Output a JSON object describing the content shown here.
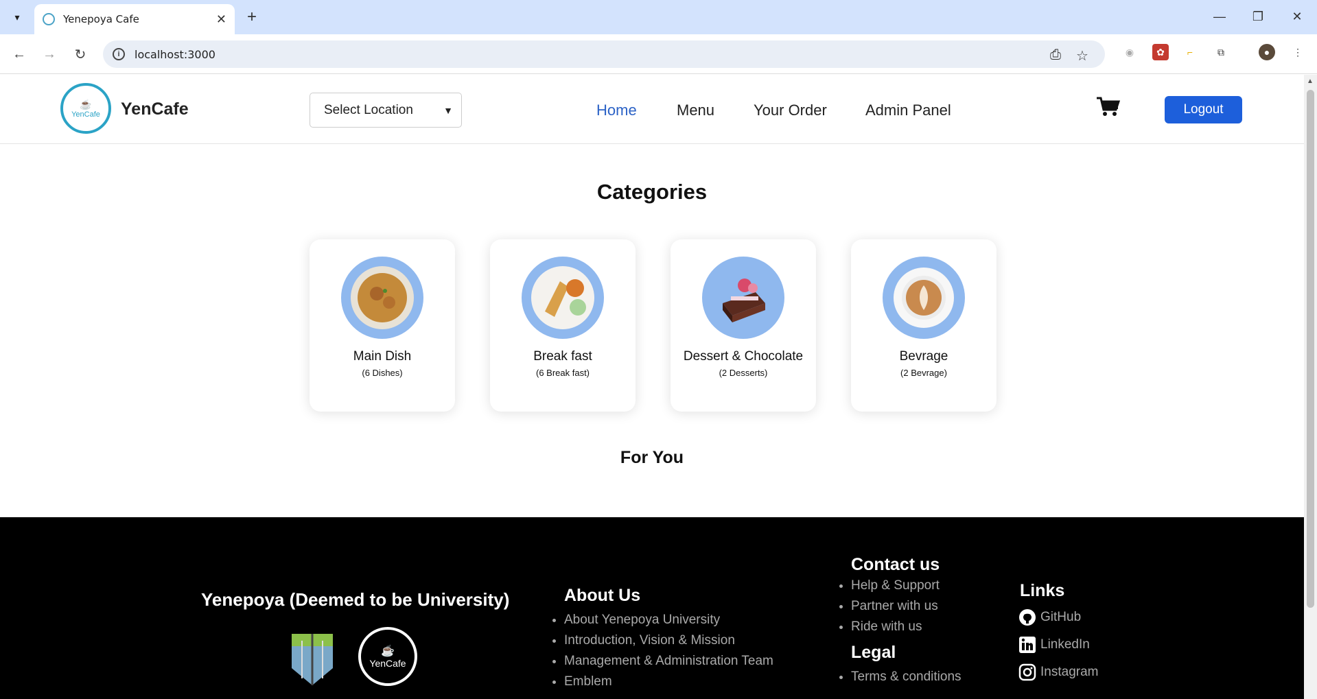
{
  "browser": {
    "tab_title": "Yenepoya Cafe",
    "url": "localhost:3000"
  },
  "header": {
    "brand": "YenCafe",
    "logo_text": "YenCafe",
    "location_select": "Select Location",
    "nav": [
      "Home",
      "Menu",
      "Your Order",
      "Admin Panel"
    ],
    "active_nav": "Home",
    "logout": "Logout"
  },
  "main": {
    "categories_title": "Categories",
    "for_you_title": "For You",
    "categories": [
      {
        "name": "Main Dish",
        "count": "(6 Dishes)",
        "icon": "biryani-plate-icon"
      },
      {
        "name": "Break fast",
        "count": "(6 Break fast)",
        "icon": "dosa-plate-icon"
      },
      {
        "name": "Dessert & Chocolate",
        "count": "(2 Desserts)",
        "icon": "cake-icon"
      },
      {
        "name": "Bevrage",
        "count": "(2 Bevrage)",
        "icon": "coffee-cup-icon"
      }
    ]
  },
  "footer": {
    "university": "Yenepoya (Deemed to be University)",
    "footer_logo_text": "YenCafe",
    "about_title": "About Us",
    "about_items": [
      "About Yenepoya University",
      "Introduction, Vision & Mission",
      "Management & Administration Team",
      "Emblem"
    ],
    "contact_title": "Contact us",
    "contact_items": [
      "Help & Support",
      "Partner with us",
      "Ride with us"
    ],
    "legal_title": "Legal",
    "legal_items": [
      "Terms & conditions"
    ],
    "links_title": "Links",
    "links": [
      "GitHub",
      "LinkedIn",
      "Instagram"
    ]
  },
  "colors": {
    "primary": "#1d5fdb",
    "active_nav": "#2b62c6",
    "card_circle": "#8fb8ee",
    "footer_bg": "#000000",
    "logo": "#2ba3c6"
  }
}
